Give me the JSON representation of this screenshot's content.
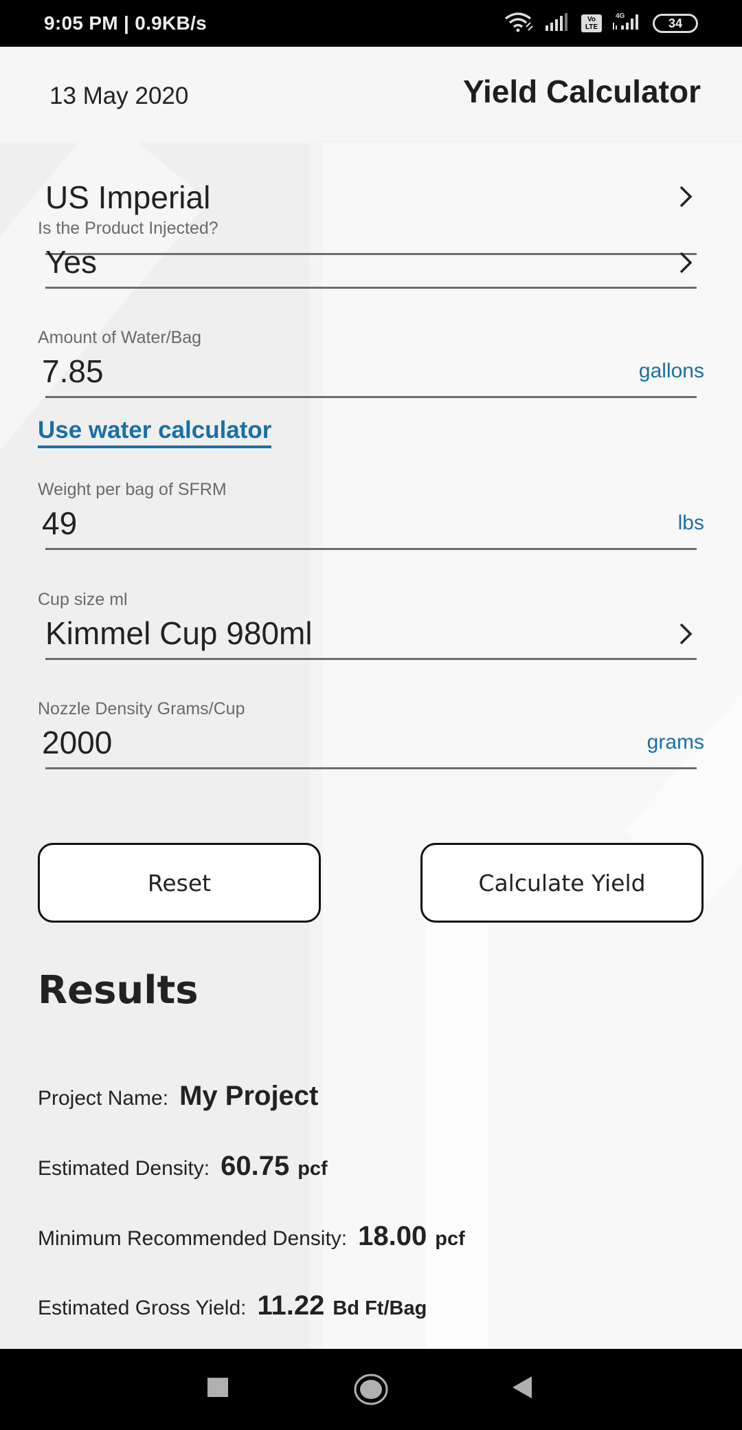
{
  "status_bar": {
    "time": "9:05 PM | 0.9KB/s",
    "icons": [
      "wifi-icon",
      "signal-icon",
      "volte-icon",
      "4g-signal-icon",
      "battery-icon"
    ],
    "volte_label": "Vo LTE",
    "network_label": "4G",
    "battery_level": "34"
  },
  "header": {
    "date": "13 May 2020",
    "title": "Yield Calculator"
  },
  "form": {
    "units": {
      "value": "US Imperial"
    },
    "injected": {
      "label": "Is the Product Injected?",
      "value": "Yes"
    },
    "water": {
      "label": "Amount of Water/Bag",
      "value": "7.85",
      "unit": "gallons"
    },
    "water_calculator_link": "Use water calculator",
    "weight": {
      "label": "Weight per bag of SFRM",
      "value": "49",
      "unit": "lbs"
    },
    "cup_size": {
      "label": "Cup size ml",
      "value": "Kimmel Cup 980ml"
    },
    "nozzle_density": {
      "label": "Nozzle Density Grams/Cup",
      "value": "2000",
      "unit": "grams"
    }
  },
  "buttons": {
    "reset": "Reset",
    "calculate": "Calculate Yield"
  },
  "results": {
    "title": "Results",
    "project_name": {
      "label": "Project Name:",
      "value": "My Project"
    },
    "estimated_density": {
      "label": "Estimated Density:",
      "value": "60.75",
      "unit": "pcf"
    },
    "min_density": {
      "label": "Minimum Recommended Density:",
      "value": "18.00",
      "unit": "pcf"
    },
    "gross_yield": {
      "label": "Estimated Gross Yield:",
      "value": "11.22",
      "unit": "Bd Ft/Bag"
    }
  },
  "nav_bar": {
    "buttons": [
      "recents-button",
      "home-button",
      "back-button"
    ]
  },
  "colors": {
    "accent": "#1a6fa6",
    "status_bar_bg": "#000000",
    "field_line": "#6d6d6d"
  }
}
